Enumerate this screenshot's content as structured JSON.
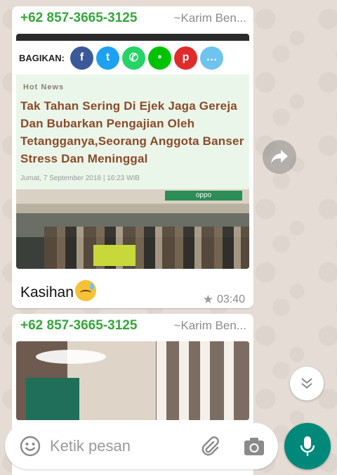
{
  "messages": [
    {
      "sender_phone": "+62 857-3665-3125",
      "sender_name": "~Karim Ben...",
      "image": {
        "share_label": "BAGIKAN:",
        "share_buttons": [
          "facebook-icon",
          "twitter-icon",
          "whatsapp-icon",
          "line-icon",
          "pinterest-icon",
          "comment-icon"
        ],
        "share_colors": [
          "#3b5998",
          "#1da1f2",
          "#25d366",
          "#00c300",
          "#e02b2b",
          "#6fc3ef"
        ],
        "category": "Hot News",
        "headline": "Tak Tahan Sering Di Ejek Jaga Gereja Dan Bubarkan Pengajian Oleh Tetangganya,Seorang Anggota Banser Stress Dan Meninggal",
        "dateline": "Jumat, 7 September 2018 | 16:23 WIB",
        "photo_sign": "oppo"
      },
      "caption": "Kasihan",
      "emoji": "sad-relieved-face-icon",
      "starred": true,
      "time": "03:40"
    },
    {
      "sender_phone": "+62 857-3665-3125",
      "sender_name": "~Karim Ben..."
    }
  ],
  "input": {
    "placeholder": "Ketik pesan"
  },
  "colors": {
    "accent": "#00897b",
    "sender_phone": "#35a63d",
    "headline": "#8b4a2a",
    "wallpaper": "#e5ddd5"
  }
}
